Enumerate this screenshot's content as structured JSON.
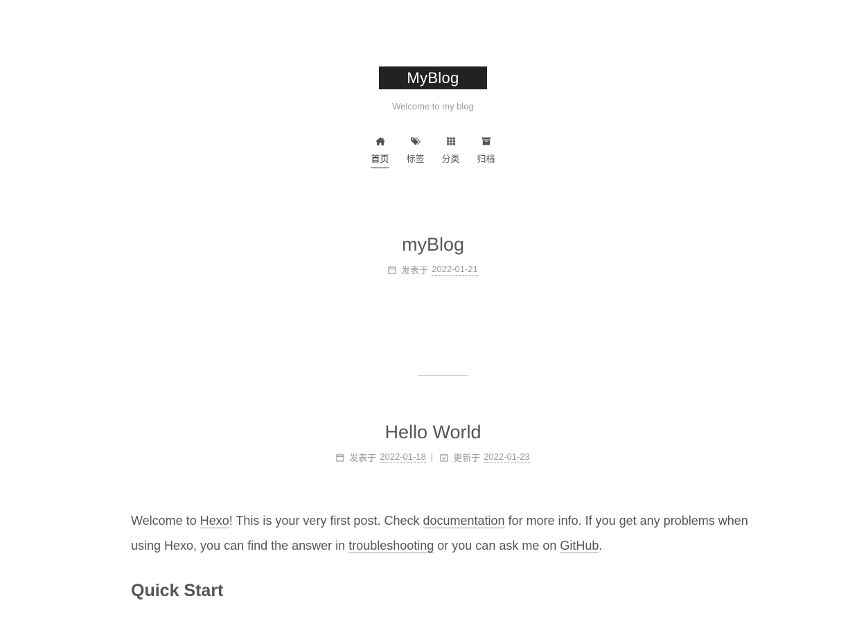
{
  "site": {
    "title": "MyBlog",
    "subtitle": "Welcome to my blog"
  },
  "menu": [
    {
      "label": "首页",
      "icon": "home-icon",
      "active": true
    },
    {
      "label": "标签",
      "icon": "tags-icon",
      "active": false
    },
    {
      "label": "分类",
      "icon": "grid-icon",
      "active": false
    },
    {
      "label": "归档",
      "icon": "archive-icon",
      "active": false
    }
  ],
  "posts": [
    {
      "title": "myBlog",
      "posted_label": "发表于",
      "posted_date": "2022-01-21"
    },
    {
      "title": "Hello World",
      "posted_label": "发表于",
      "posted_date": "2022-01-18",
      "separator": "|",
      "updated_label": "更新于",
      "updated_date": "2022-01-23",
      "body": {
        "p1_a": "Welcome to ",
        "p1_link1": "Hexo",
        "p1_b": "! This is your very first post. Check ",
        "p1_link2": "documentation",
        "p1_c": " for more info. If you get any problems when using Hexo, you can find the answer in ",
        "p1_link3": "troubleshooting",
        "p1_d": " or you can ask me on ",
        "p1_link4": "GitHub",
        "p1_e": ".",
        "heading": "Quick Start"
      }
    }
  ],
  "colors": {
    "brand_bg": "#222222",
    "text": "#555555",
    "muted": "#999999"
  }
}
